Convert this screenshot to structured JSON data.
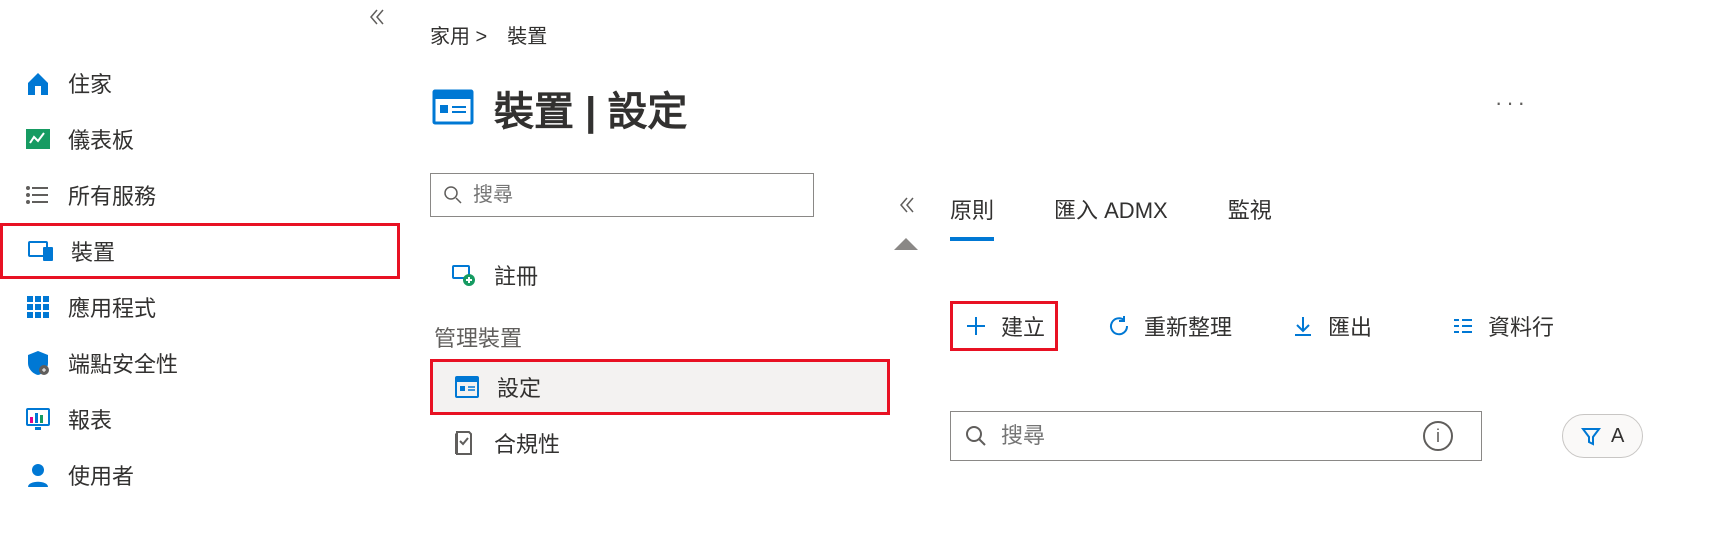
{
  "sidebar": {
    "items": [
      {
        "label": "住家"
      },
      {
        "label": "儀表板"
      },
      {
        "label": "所有服務"
      },
      {
        "label": "裝置"
      },
      {
        "label": "應用程式"
      },
      {
        "label": "端點安全性"
      },
      {
        "label": "報表"
      },
      {
        "label": "使用者"
      }
    ]
  },
  "breadcrumb": {
    "home": "家用 >",
    "current": "裝置"
  },
  "page": {
    "title": "裝置 | 設定"
  },
  "middle": {
    "search_placeholder": "搜尋",
    "items": {
      "register": "註冊",
      "section": "管理裝置",
      "settings": "設定",
      "compliance": "合規性"
    }
  },
  "tabs": {
    "policy": "原則",
    "admx": "匯入 ADMX",
    "monitor": "監視"
  },
  "toolbar": {
    "create": "建立",
    "refresh": "重新整理",
    "export": "匯出",
    "columns": "資料行"
  },
  "content": {
    "search_placeholder": "搜尋",
    "filter_label": "A"
  }
}
